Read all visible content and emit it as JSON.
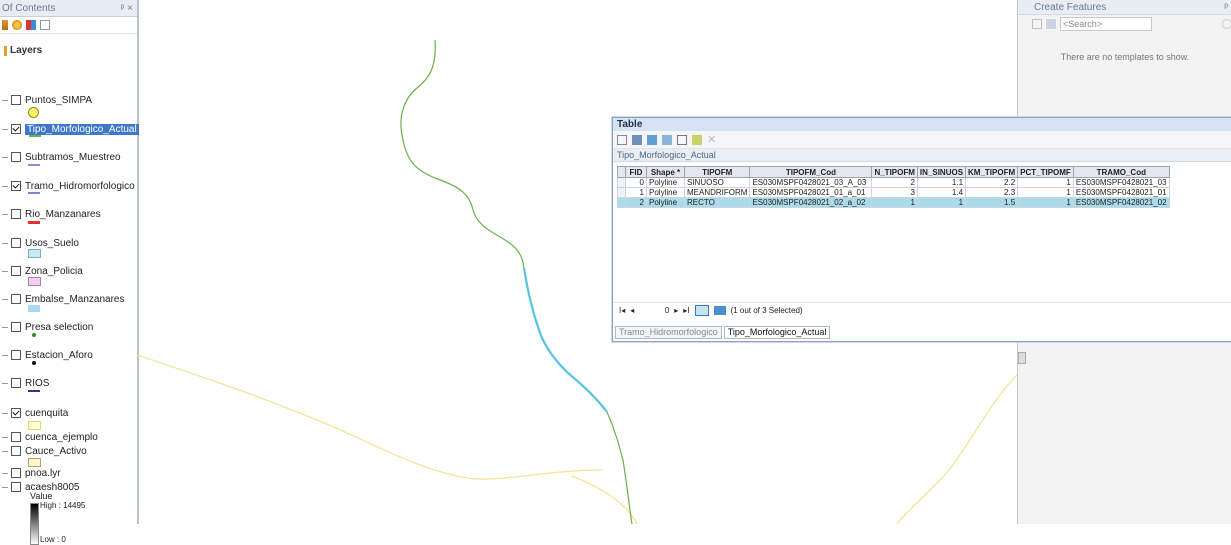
{
  "toc": {
    "title": "Of Contents",
    "title_controls": "p ×",
    "root": "Layers",
    "layers": [
      {
        "name": "Puntos_SIMPA",
        "checked": false,
        "symbol": "yellow-circle"
      },
      {
        "name": "Tipo_Morfologico_Actual",
        "checked": true,
        "symbol": "green-line",
        "selected": true
      },
      {
        "name": "Subtramos_Muestreo",
        "checked": false,
        "symbol": "purple-line"
      },
      {
        "name": "Tramo_Hidromorfologico",
        "checked": true,
        "symbol": "blue-line"
      },
      {
        "name": "Rio_Manzanares",
        "checked": false,
        "symbol": "red-line"
      },
      {
        "name": "Usos_Suelo",
        "checked": false,
        "symbol": "cyan-box"
      },
      {
        "name": "Zona_Policia",
        "checked": false,
        "symbol": "pink-box"
      },
      {
        "name": "Embalse_Manzanares",
        "checked": false,
        "symbol": "lightblue-box"
      },
      {
        "name": "Presa selection",
        "checked": false,
        "symbol": "green-dot"
      },
      {
        "name": "Estacion_Aforo",
        "checked": false,
        "symbol": "black-dot"
      },
      {
        "name": "RIOS",
        "checked": false,
        "symbol": "navy-line"
      },
      {
        "name": "cuenquita",
        "checked": true,
        "symbol": "yellow-box"
      },
      {
        "name": "cuenca_ejemplo",
        "checked": false,
        "symbol": "none"
      },
      {
        "name": "Cauce_Activo",
        "checked": false,
        "symbol": "tan-box"
      },
      {
        "name": "pnoa.lyr",
        "checked": false,
        "symbol": "none"
      },
      {
        "name": "acaesh8005",
        "checked": false,
        "symbol": "gradient"
      }
    ],
    "legend": {
      "title": "Value",
      "high": "High : 14495",
      "low": "Low : 0"
    }
  },
  "create_features": {
    "title": "Create Features",
    "search_placeholder": "<Search>",
    "empty_message": "There are no templates to show."
  },
  "table": {
    "window_title": "Table",
    "layer_name": "Tipo_Morfologico_Actual",
    "columns": [
      "FID",
      "Shape *",
      "TIPOFM",
      "TIPOFM_Cod",
      "N_TIPOFM",
      "IN_SINUOS",
      "KM_TIPOFM",
      "PCT_TIPOMF",
      "TRAMO_Cod"
    ],
    "rows": [
      {
        "fid": "0",
        "shape": "Polyline",
        "tipofm": "SINUOSO",
        "cod": "ES030MSPF0428021_03_A_03",
        "n": "2",
        "in": "1.1",
        "km": "2.2",
        "pct": "1",
        "tramo": "ES030MSPF0428021_03",
        "selected": false
      },
      {
        "fid": "1",
        "shape": "Polyline",
        "tipofm": "MEANDRIFORM",
        "cod": "ES030MSPF0428021_01_a_01",
        "n": "3",
        "in": "1.4",
        "km": "2.3",
        "pct": "1",
        "tramo": "ES030MSPF0428021_01",
        "selected": false
      },
      {
        "fid": "2",
        "shape": "Polyline",
        "tipofm": "RECTO",
        "cod": "ES030MSPF0428021_02_a_02",
        "n": "1",
        "in": "1",
        "km": "1.5",
        "pct": "1",
        "tramo": "ES030MSPF0428021_02",
        "selected": true
      }
    ],
    "record_index": "0",
    "selection_status": "(1 out of 3 Selected)",
    "tabs": [
      "Tramo_Hidromorfologico",
      "Tipo_Morfologico_Actual"
    ],
    "active_tab": 1
  },
  "colors": {
    "river": "#6bb04a",
    "selected_river": "#56c3e3",
    "basin": "#f3e597",
    "selection_blue": "#3e78c9"
  }
}
